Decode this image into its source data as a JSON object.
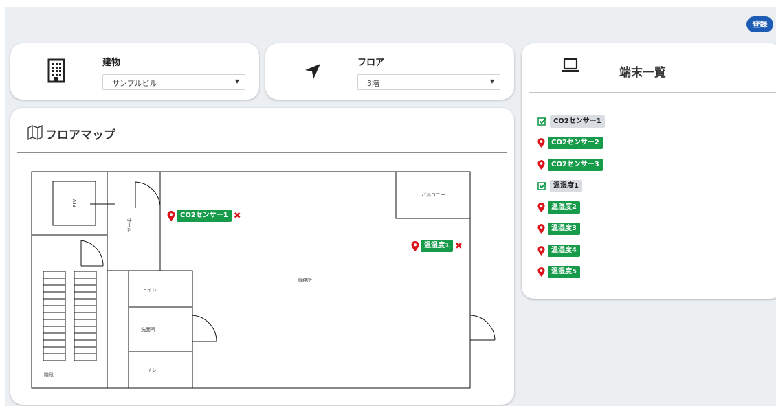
{
  "header": {
    "register_label": "登録"
  },
  "building": {
    "label": "建物",
    "selected": "サンプルビル",
    "icon": "building-icon"
  },
  "floor": {
    "label": "フロア",
    "selected": "3階",
    "icon": "navigation-arrow-icon"
  },
  "devices": {
    "title": "端末一覧",
    "icon": "laptop-icon",
    "items": [
      {
        "label": "CO2センサー1",
        "state": "placed",
        "icon": "check-square-icon"
      },
      {
        "label": "CO2センサー2",
        "state": "unplaced",
        "icon": "map-pin-icon"
      },
      {
        "label": "CO2センサー3",
        "state": "unplaced",
        "icon": "map-pin-icon"
      },
      {
        "label": "温湿度1",
        "state": "placed",
        "icon": "check-square-icon"
      },
      {
        "label": "温湿度2",
        "state": "unplaced",
        "icon": "map-pin-icon"
      },
      {
        "label": "温湿度3",
        "state": "unplaced",
        "icon": "map-pin-icon"
      },
      {
        "label": "温湿度4",
        "state": "unplaced",
        "icon": "map-pin-icon"
      },
      {
        "label": "温湿度5",
        "state": "unplaced",
        "icon": "map-pin-icon"
      }
    ]
  },
  "map": {
    "title": "フロアマップ",
    "icon": "map-icon",
    "rooms": {
      "elv": "ELV",
      "hall": "ホール",
      "balcony": "バルコニー",
      "office": "事務所",
      "toilet_top": "トイレ",
      "washroom": "洗面所",
      "toilet_bottom": "トイレ",
      "stairs": "階段"
    },
    "markers": [
      {
        "label": "CO2センサー1",
        "remove_icon": "close-icon"
      },
      {
        "label": "温湿度1",
        "remove_icon": "close-icon"
      }
    ]
  },
  "colors": {
    "accent": "#1d5cb5",
    "tag_green": "#159b4a",
    "pin_red": "#d9141a",
    "check_green": "#159b4a"
  }
}
